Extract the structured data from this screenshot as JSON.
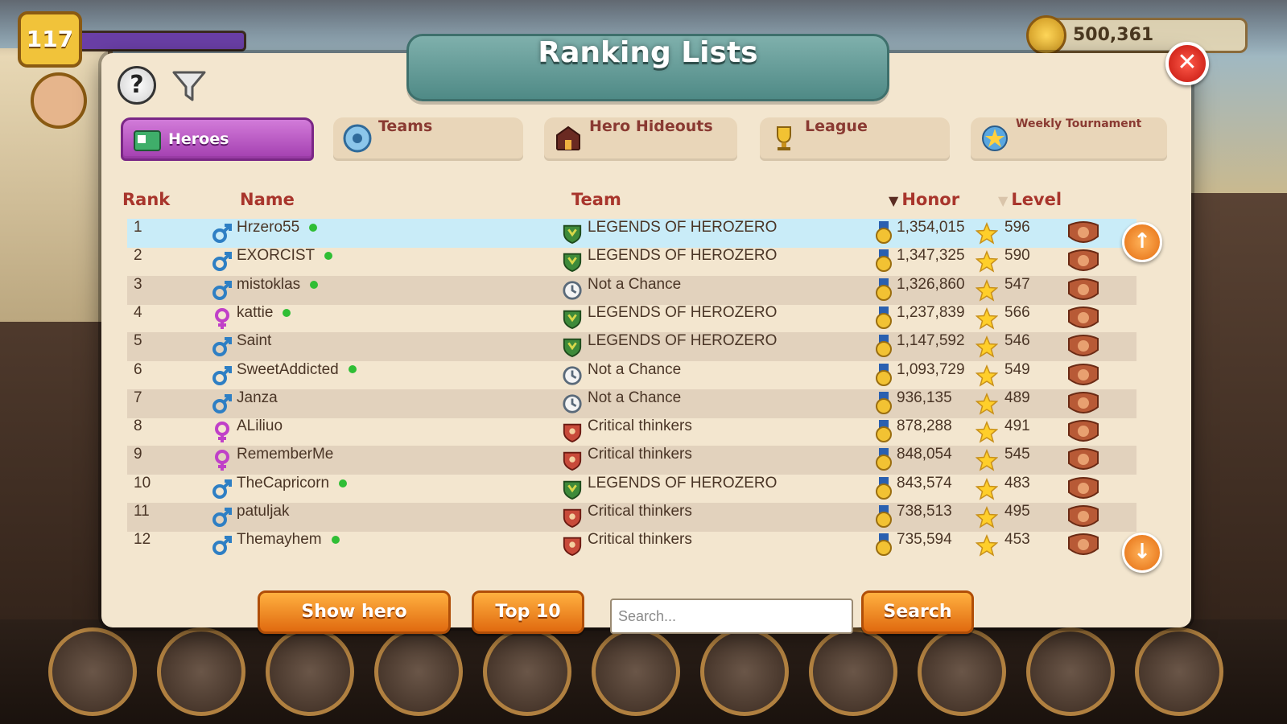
{
  "hud": {
    "level": "117",
    "gold": "500,361"
  },
  "dialog": {
    "title": "Ranking Lists",
    "help_label": "?",
    "close_label": "✕"
  },
  "tabs": [
    {
      "label": "Heroes",
      "icon": "hero-card-icon",
      "active": true
    },
    {
      "label": "Teams",
      "icon": "team-emblem-icon",
      "active": false
    },
    {
      "label": "Hero Hideouts",
      "icon": "hideout-icon",
      "active": false
    },
    {
      "label": "League",
      "icon": "trophy-icon",
      "active": false
    },
    {
      "label": "Weekly Tournament",
      "icon": "tournament-icon",
      "active": false
    }
  ],
  "columns": {
    "rank": "Rank",
    "name": "Name",
    "team": "Team",
    "honor": "Honor",
    "level": "Level"
  },
  "rows": [
    {
      "rank": "1",
      "gender": "male",
      "name": "Hrzero55",
      "online": true,
      "team": "LEGENDS OF HEROZERO",
      "team_icon": "green-shield",
      "honor": "1,354,015",
      "level": "596"
    },
    {
      "rank": "2",
      "gender": "male",
      "name": "EXORCIST",
      "online": true,
      "team": "LEGENDS OF HEROZERO",
      "team_icon": "green-shield",
      "honor": "1,347,325",
      "level": "590"
    },
    {
      "rank": "3",
      "gender": "male",
      "name": "mistoklas",
      "online": true,
      "team": "Not a Chance",
      "team_icon": "clock",
      "honor": "1,326,860",
      "level": "547"
    },
    {
      "rank": "4",
      "gender": "female",
      "name": "kattie",
      "online": true,
      "team": "LEGENDS OF HEROZERO",
      "team_icon": "green-shield",
      "honor": "1,237,839",
      "level": "566"
    },
    {
      "rank": "5",
      "gender": "male",
      "name": "Saint",
      "online": false,
      "team": "LEGENDS OF HEROZERO",
      "team_icon": "green-shield",
      "honor": "1,147,592",
      "level": "546"
    },
    {
      "rank": "6",
      "gender": "male",
      "name": "SweetAddicted",
      "online": true,
      "team": "Not a Chance",
      "team_icon": "clock",
      "honor": "1,093,729",
      "level": "549"
    },
    {
      "rank": "7",
      "gender": "male",
      "name": "Janza",
      "online": false,
      "team": "Not a Chance",
      "team_icon": "clock",
      "honor": "936,135",
      "level": "489"
    },
    {
      "rank": "8",
      "gender": "female",
      "name": "ALiliuo",
      "online": false,
      "team": "Critical thinkers",
      "team_icon": "red-shield",
      "honor": "878,288",
      "level": "491"
    },
    {
      "rank": "9",
      "gender": "female",
      "name": "RememberMe",
      "online": false,
      "team": "Critical thinkers",
      "team_icon": "red-shield",
      "honor": "848,054",
      "level": "545"
    },
    {
      "rank": "10",
      "gender": "male",
      "name": "TheCapricorn",
      "online": true,
      "team": "LEGENDS OF HEROZERO",
      "team_icon": "green-shield",
      "honor": "843,574",
      "level": "483"
    },
    {
      "rank": "11",
      "gender": "male",
      "name": "patuljak",
      "online": false,
      "team": "Critical thinkers",
      "team_icon": "red-shield",
      "honor": "738,513",
      "level": "495"
    },
    {
      "rank": "12",
      "gender": "male",
      "name": "Themayhem",
      "online": true,
      "team": "Critical thinkers",
      "team_icon": "red-shield",
      "honor": "735,594",
      "level": "453"
    }
  ],
  "controls": {
    "show_hero": "Show hero",
    "top10": "Top 10",
    "search_placeholder": "Search...",
    "search_button": "Search"
  },
  "colors": {
    "panel": "#f3e6cf",
    "header_text": "#a8352c",
    "tab_active": "#a33fb0",
    "button_orange": "#e06a10",
    "selected_row": "#c9ecf8"
  }
}
